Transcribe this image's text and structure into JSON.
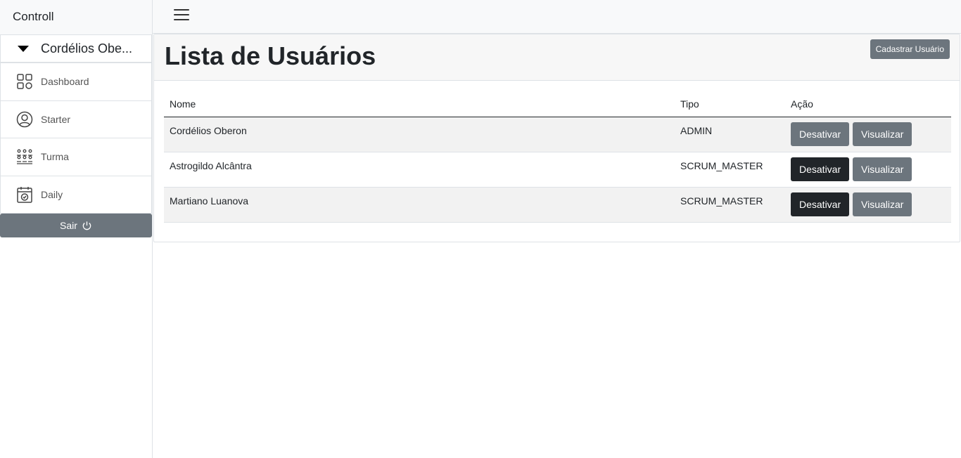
{
  "sidebar": {
    "brand": "Controll",
    "user_name": "Cordélios Obe...",
    "items": [
      {
        "label": "Dashboard",
        "icon": "dashboard-grid-icon"
      },
      {
        "label": "Starter",
        "icon": "user-circle-icon"
      },
      {
        "label": "Turma",
        "icon": "class-group-icon"
      },
      {
        "label": "Daily",
        "icon": "calendar-check-icon"
      }
    ],
    "logout_label": "Sair"
  },
  "header": {
    "menu_icon": "hamburger-menu-icon"
  },
  "main": {
    "title": "Lista de Usuários",
    "register_button": "Cadastrar Usuário",
    "table": {
      "columns": [
        "Nome",
        "Tipo",
        "Ação"
      ],
      "rows": [
        {
          "nome": "Cordélios Oberon",
          "tipo": "ADMIN",
          "deactivate": "Desativar",
          "view": "Visualizar"
        },
        {
          "nome": "Astrogildo Alcântra",
          "tipo": "SCRUM_MASTER",
          "deactivate": "Desativar",
          "view": "Visualizar"
        },
        {
          "nome": "Martiano Luanova",
          "tipo": "SCRUM_MASTER",
          "deactivate": "Desativar",
          "view": "Visualizar"
        }
      ]
    }
  },
  "colors": {
    "secondary": "#6c757d",
    "dark": "#212529",
    "light": "#f8f9fa"
  }
}
